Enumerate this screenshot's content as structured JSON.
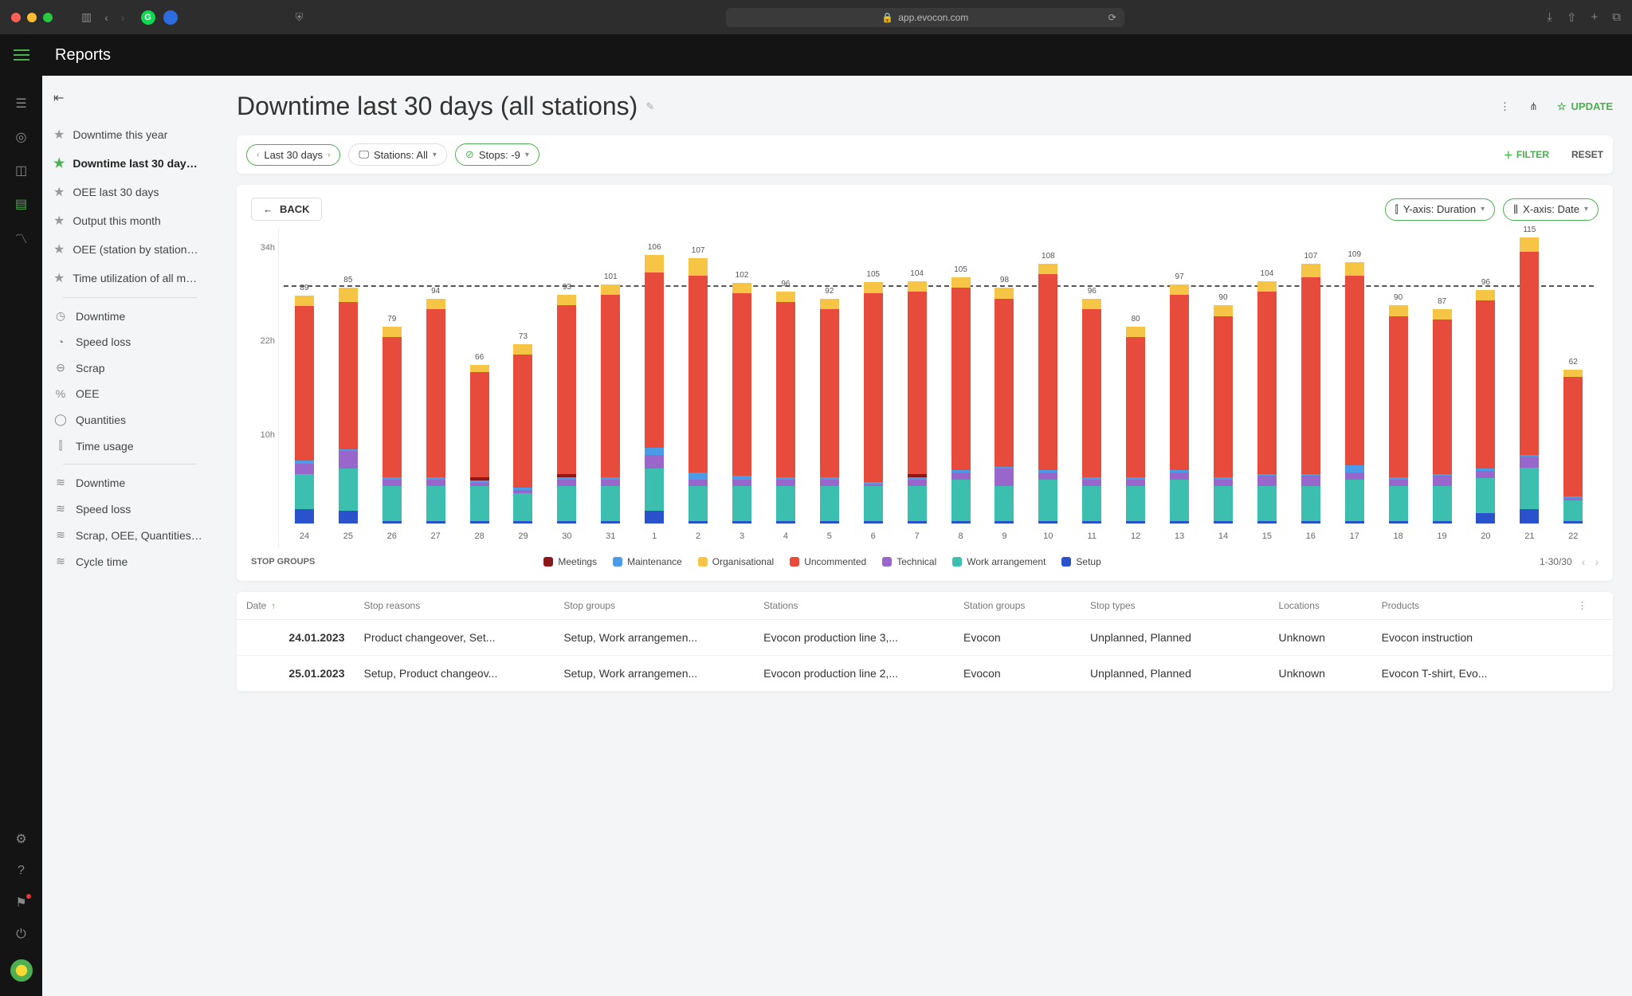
{
  "browser": {
    "url": "app.evocon.com"
  },
  "header": {
    "title": "Reports"
  },
  "sidebar": {
    "favorites": [
      {
        "label": "Downtime this year",
        "selected": false
      },
      {
        "label": "Downtime last 30 days (al...",
        "selected": true
      },
      {
        "label": "OEE last 30 days",
        "selected": false
      },
      {
        "label": "Output this month",
        "selected": false
      },
      {
        "label": "OEE (station by station co...",
        "selected": false
      },
      {
        "label": "Time utilization of all mac...",
        "selected": false
      }
    ],
    "reports1": [
      {
        "label": "Downtime",
        "icon": "clock"
      },
      {
        "label": "Speed loss",
        "icon": "gauge"
      },
      {
        "label": "Scrap",
        "icon": "minus-circle"
      },
      {
        "label": "OEE",
        "icon": "percent"
      },
      {
        "label": "Quantities",
        "icon": "circle"
      },
      {
        "label": "Time usage",
        "icon": "bars"
      }
    ],
    "reports2": [
      {
        "label": "Downtime",
        "icon": "layers"
      },
      {
        "label": "Speed loss",
        "icon": "layers"
      },
      {
        "label": "Scrap, OEE, Quantities, Ti...",
        "icon": "layers"
      },
      {
        "label": "Cycle time",
        "icon": "layers"
      }
    ]
  },
  "page": {
    "title": "Downtime last 30 days (all stations)",
    "update_label": "UPDATE",
    "filters": {
      "range": "Last 30 days",
      "stations": "Stations: All",
      "stops": "Stops: -9",
      "filter_label": "FILTER",
      "reset_label": "RESET"
    },
    "back_label": "BACK",
    "axis_y": "Y-axis: Duration",
    "axis_x": "X-axis: Date",
    "legend_title": "STOP GROUPS",
    "legend": [
      {
        "name": "Meetings",
        "cls": "c-meetings"
      },
      {
        "name": "Maintenance",
        "cls": "c-maint"
      },
      {
        "name": "Organisational",
        "cls": "c-org"
      },
      {
        "name": "Uncommented",
        "cls": "c-uncom"
      },
      {
        "name": "Technical",
        "cls": "c-tech"
      },
      {
        "name": "Work arrangement",
        "cls": "c-work"
      },
      {
        "name": "Setup",
        "cls": "c-setup"
      }
    ],
    "pager": "1-30/30",
    "y_ticks": [
      "34h",
      "22h",
      "10h",
      ""
    ],
    "table": {
      "cols": [
        "Date",
        "Stop reasons",
        "Stop groups",
        "Stations",
        "Station groups",
        "Stop types",
        "Locations",
        "Products"
      ],
      "rows": [
        {
          "date": "24.01.2023",
          "reasons": "Product changeover, Set...",
          "groups": "Setup, Work arrangemen...",
          "stations": "Evocon production line 3,...",
          "sg": "Evocon",
          "types": "Unplanned, Planned",
          "loc": "Unknown",
          "prod": "Evocon instruction"
        },
        {
          "date": "25.01.2023",
          "reasons": "Setup, Product changeov...",
          "groups": "Setup, Work arrangemen...",
          "stations": "Evocon production line 2,...",
          "sg": "Evocon",
          "types": "Unplanned, Planned",
          "loc": "Unknown",
          "prod": "Evocon T-shirt, Evo..."
        }
      ]
    }
  },
  "chart_data": {
    "type": "bar",
    "stacked": true,
    "title": "Downtime last 30 days (all stations)",
    "xlabel": "Date",
    "ylabel": "Duration (hours)",
    "ylim": [
      0,
      40
    ],
    "y_ticks_h": [
      10,
      22,
      34
    ],
    "average_line_h": 34,
    "categories": [
      "24",
      "25",
      "26",
      "27",
      "28",
      "29",
      "30",
      "31",
      "1",
      "2",
      "3",
      "4",
      "5",
      "6",
      "7",
      "8",
      "9",
      "10",
      "11",
      "12",
      "13",
      "14",
      "15",
      "16",
      "17",
      "18",
      "19",
      "20",
      "21",
      "22"
    ],
    "bar_totals": [
      89,
      85,
      79,
      94,
      66,
      73,
      93,
      101,
      106,
      107,
      102,
      96,
      92,
      105,
      104,
      105,
      98,
      108,
      96,
      80,
      97,
      90,
      104,
      107,
      109,
      90,
      87,
      96,
      115,
      62
    ],
    "series": [
      {
        "name": "Setup",
        "cls": "c-setup",
        "values": [
          2.0,
          1.8,
          0.3,
          0.3,
          0.3,
          0.3,
          0.3,
          0.3,
          1.8,
          0.3,
          0.3,
          0.3,
          0.3,
          0.3,
          0.3,
          0.3,
          0.3,
          0.3,
          0.3,
          0.3,
          0.3,
          0.3,
          0.3,
          0.3,
          0.3,
          0.3,
          0.3,
          1.5,
          2.0,
          0.3
        ]
      },
      {
        "name": "Work arrangement",
        "cls": "c-work",
        "values": [
          5,
          6,
          5,
          5,
          5,
          4,
          5,
          5,
          6,
          5,
          5,
          5,
          5,
          5,
          5,
          6,
          5,
          6,
          5,
          5,
          6,
          5,
          5,
          5,
          6,
          5,
          5,
          5,
          6,
          3
        ]
      },
      {
        "name": "Technical",
        "cls": "c-tech",
        "values": [
          1.5,
          2.5,
          1.0,
          1.0,
          0.5,
          0.5,
          1.0,
          1.0,
          2.0,
          1.0,
          1.0,
          1.0,
          1.0,
          0.3,
          1.0,
          1.0,
          2.5,
          1.0,
          1.0,
          1.0,
          1.0,
          1.0,
          1.5,
          1.5,
          1.0,
          1.0,
          1.5,
          1.0,
          1.5,
          0.3
        ]
      },
      {
        "name": "Maintenance",
        "cls": "c-maint",
        "values": [
          0.5,
          0.3,
          0.3,
          0.3,
          0.3,
          0.3,
          0.3,
          0.3,
          1.0,
          1.0,
          0.5,
          0.3,
          0.3,
          0.3,
          0.3,
          0.3,
          0.3,
          0.3,
          0.3,
          0.3,
          0.3,
          0.3,
          0.3,
          0.3,
          1.0,
          0.3,
          0.3,
          0.3,
          0.3,
          0.3
        ]
      },
      {
        "name": "Meetings",
        "cls": "c-meetings",
        "values": [
          0,
          0,
          0,
          0,
          0.5,
          0,
          0.5,
          0,
          0,
          0,
          0,
          0,
          0,
          0,
          0.5,
          0,
          0,
          0,
          0,
          0,
          0,
          0,
          0,
          0,
          0,
          0,
          0,
          0,
          0,
          0
        ]
      },
      {
        "name": "Uncommented",
        "cls": "c-uncom",
        "values": [
          22,
          21,
          20,
          24,
          15,
          19,
          24,
          26,
          25,
          28,
          26,
          25,
          24,
          27,
          26,
          26,
          24,
          28,
          24,
          20,
          25,
          23,
          26,
          28,
          27,
          23,
          22,
          24,
          29,
          17
        ]
      },
      {
        "name": "Organisational",
        "cls": "c-org",
        "values": [
          1.5,
          2.0,
          1.5,
          1.5,
          1.0,
          1.5,
          1.5,
          1.5,
          2.5,
          2.5,
          1.5,
          1.5,
          1.5,
          1.5,
          1.5,
          1.5,
          1.5,
          1.5,
          1.5,
          1.5,
          1.5,
          1.5,
          1.5,
          2.0,
          2.0,
          1.5,
          1.5,
          1.5,
          2.0,
          1.0
        ]
      }
    ]
  }
}
